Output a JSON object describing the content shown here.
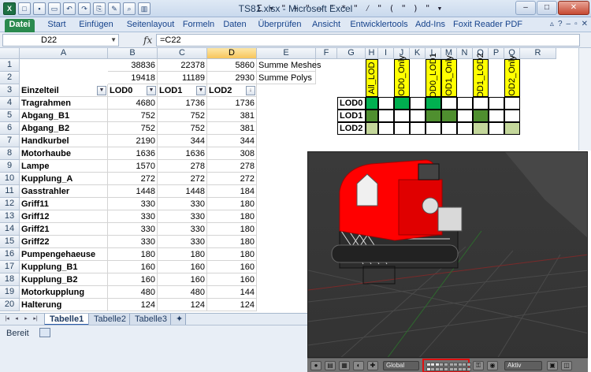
{
  "window": {
    "title": "TS81.xlsx - Microsoft Excel",
    "formula_symbols": "Σ ▾ \" + \" – \" * \" ⁄ \" ( \" ) \" ▾",
    "controls": [
      "–",
      "□",
      "✕"
    ]
  },
  "ribbon": {
    "tabs": [
      "Datei",
      "Start",
      "Einfügen",
      "Seitenlayout",
      "Formeln",
      "Daten",
      "Überprüfen",
      "Ansicht",
      "Entwicklertools",
      "Add-Ins",
      "Foxit Reader PDF"
    ]
  },
  "formula_bar": {
    "name_box": "D22",
    "fx": "fx",
    "formula": "=C22"
  },
  "columns": [
    "A",
    "B",
    "C",
    "D",
    "E",
    "F",
    "G",
    "H",
    "I",
    "J",
    "K",
    "L",
    "M",
    "N",
    "O",
    "P",
    "Q",
    "R"
  ],
  "rows": [
    "1",
    "2",
    "3",
    "4",
    "5",
    "6",
    "7",
    "8",
    "9",
    "10",
    "11",
    "12",
    "13",
    "14",
    "15",
    "16",
    "17",
    "18",
    "19",
    "20"
  ],
  "sheet": {
    "row1": {
      "b": "38836",
      "c": "22378",
      "d": "5860",
      "e": "Summe Meshes"
    },
    "row2": {
      "b": "19418",
      "c": "11189",
      "d": "2930",
      "e": "Summe Polys"
    },
    "header": {
      "a": "Einzelteil",
      "b": "LOD0",
      "c": "LOD1",
      "d": "LOD2"
    },
    "items": [
      {
        "name": "Tragrahmen",
        "lod0": "4680",
        "lod1": "1736",
        "lod2": "1736"
      },
      {
        "name": "Abgang_B1",
        "lod0": "752",
        "lod1": "752",
        "lod2": "381"
      },
      {
        "name": "Abgang_B2",
        "lod0": "752",
        "lod1": "752",
        "lod2": "381"
      },
      {
        "name": "Handkurbel",
        "lod0": "2190",
        "lod1": "344",
        "lod2": "344"
      },
      {
        "name": "Motorhaube",
        "lod0": "1636",
        "lod1": "1636",
        "lod2": "308"
      },
      {
        "name": "Lampe",
        "lod0": "1570",
        "lod1": "278",
        "lod2": "278"
      },
      {
        "name": "Kupplung_A",
        "lod0": "272",
        "lod1": "272",
        "lod2": "272"
      },
      {
        "name": "Gasstrahler",
        "lod0": "1448",
        "lod1": "1448",
        "lod2": "184"
      },
      {
        "name": "Griff11",
        "lod0": "330",
        "lod1": "330",
        "lod2": "180"
      },
      {
        "name": "Griff12",
        "lod0": "330",
        "lod1": "330",
        "lod2": "180"
      },
      {
        "name": "Griff21",
        "lod0": "330",
        "lod1": "330",
        "lod2": "180"
      },
      {
        "name": "Griff22",
        "lod0": "330",
        "lod1": "330",
        "lod2": "180"
      },
      {
        "name": "Pumpengehaeuse",
        "lod0": "180",
        "lod1": "180",
        "lod2": "180"
      },
      {
        "name": "Kupplung_B1",
        "lod0": "160",
        "lod1": "160",
        "lod2": "160"
      },
      {
        "name": "Kupplung_B2",
        "lod0": "160",
        "lod1": "160",
        "lod2": "160"
      },
      {
        "name": "Motorkupplung",
        "lod0": "480",
        "lod1": "480",
        "lod2": "144"
      },
      {
        "name": "Halterung",
        "lod0": "124",
        "lod1": "124",
        "lod2": "124"
      }
    ]
  },
  "matrix": {
    "headers": [
      "All_LOD",
      "LOD0_Only",
      "LOD0_LOD1",
      "LOD1_Only",
      "LOD1_LOD2",
      "LOD2_Only"
    ],
    "rows": [
      "LOD0",
      "LOD1",
      "LOD2"
    ],
    "header_color": "#ffff00",
    "colors": {
      "dark": "#00b050",
      "mid": "#4f8f2f",
      "light": "#c4d79b"
    }
  },
  "sheet_tabs": [
    "Tabelle1",
    "Tabelle2",
    "Tabelle3"
  ],
  "status": {
    "text": "Bereit"
  },
  "viewport": {
    "global_label": "Global",
    "pivot_label": "Aktiv",
    "highlight_color": "#e01010",
    "model_color": "#ff0000"
  }
}
